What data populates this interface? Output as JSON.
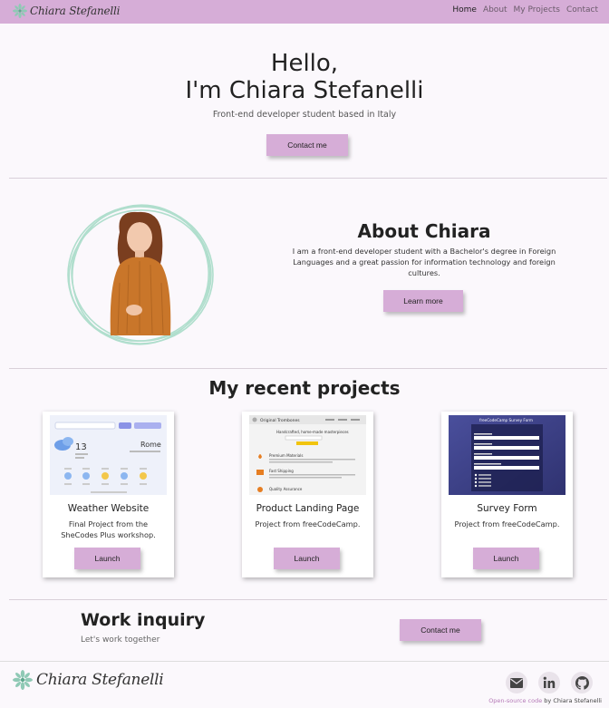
{
  "nav": {
    "brand": "Chiara Stefanelli",
    "links": [
      "Home",
      "About",
      "My Projects",
      "Contact"
    ]
  },
  "hero": {
    "line1": "Hello,",
    "line2": "I'm Chiara Stefanelli",
    "subtitle": "Front-end developer student based in Italy",
    "button": "Contact me"
  },
  "about": {
    "title": "About Chiara",
    "text": "I am a front-end developer student with a Bachelor's degree in Foreign Languages and a great passion for information technology and foreign cultures.",
    "button": "Learn more"
  },
  "projects": {
    "title": "My recent projects",
    "items": [
      {
        "title": "Weather Website",
        "desc": "Final Project from the SheCodes Plus workshop.",
        "button": "Launch"
      },
      {
        "title": "Product Landing Page",
        "desc": "Project from freeCodeCamp.",
        "button": "Launch"
      },
      {
        "title": "Survey Form",
        "desc": "Project from freeCodeCamp.",
        "button": "Launch"
      }
    ],
    "weather_thumb": {
      "temp": "13",
      "city": "Rome"
    },
    "landing_thumb": {
      "brand": "Original Trombones",
      "headline": "Handcrafted, home-made masterpieces",
      "features": [
        "Premium Materials",
        "Fast Shipping",
        "Quality Assurance"
      ]
    },
    "survey_thumb": {
      "title": "freeCodeCamp Survey Form"
    }
  },
  "work": {
    "title": "Work inquiry",
    "subtitle": "Let's work together",
    "button": "Contact me"
  },
  "footer": {
    "brand": "Chiara Stefanelli",
    "social_icons": [
      "envelope-icon",
      "linkedin-icon",
      "github-icon"
    ],
    "credit_link": "Open-source code",
    "credit_rest": " by Chiara Stefanelli"
  },
  "colors": {
    "accent": "#d6add7",
    "background": "#fbf8fc",
    "circle": "#a8dcc8"
  }
}
